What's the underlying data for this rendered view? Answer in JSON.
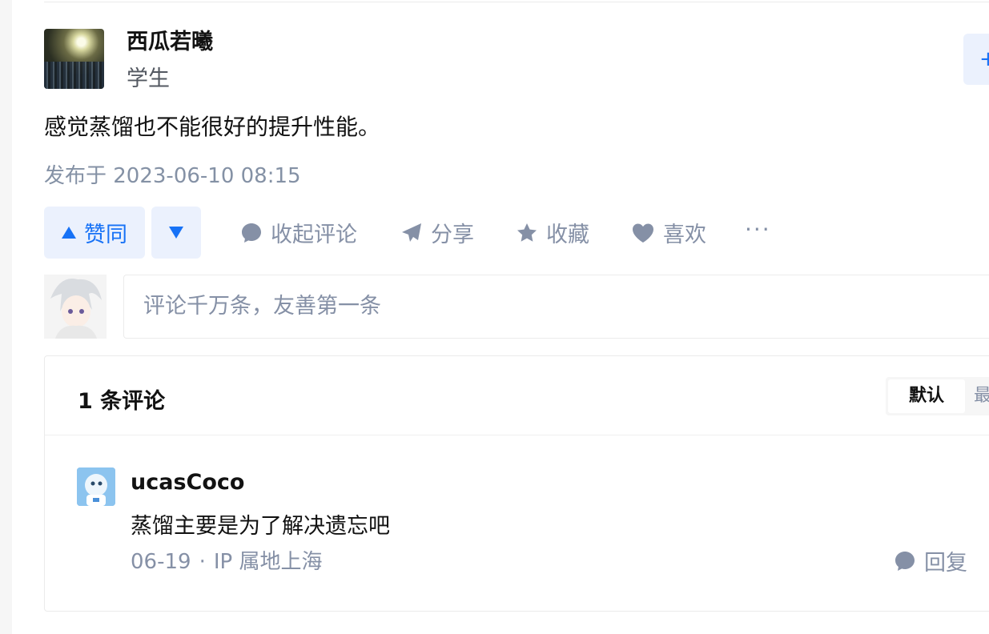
{
  "author": {
    "name": "西瓜若曦",
    "bio": "学生",
    "follow_label": "+"
  },
  "answer": {
    "content": "感觉蒸馏也不能很好的提升性能。",
    "published": "发布于 2023-06-10 08:15"
  },
  "actions": {
    "upvote_label": "赞同",
    "collapse_comments_label": "收起评论",
    "share_label": "分享",
    "favorite_label": "收藏",
    "like_label": "喜欢",
    "more_label": "···"
  },
  "comment_input": {
    "placeholder": "评论千万条，友善第一条"
  },
  "comments": {
    "count_label": "1 条评论",
    "sort_default": "默认",
    "sort_time": "最新",
    "items": [
      {
        "user": "ucasCoco",
        "text": "蒸馏主要是为了解决遗忘吧",
        "date": "06-19",
        "location": "IP 属地上海",
        "reply_label": "回复"
      }
    ]
  },
  "colors": {
    "accent": "#1772f6",
    "accent_bg": "#ebf1fd",
    "muted": "#8590a6"
  }
}
